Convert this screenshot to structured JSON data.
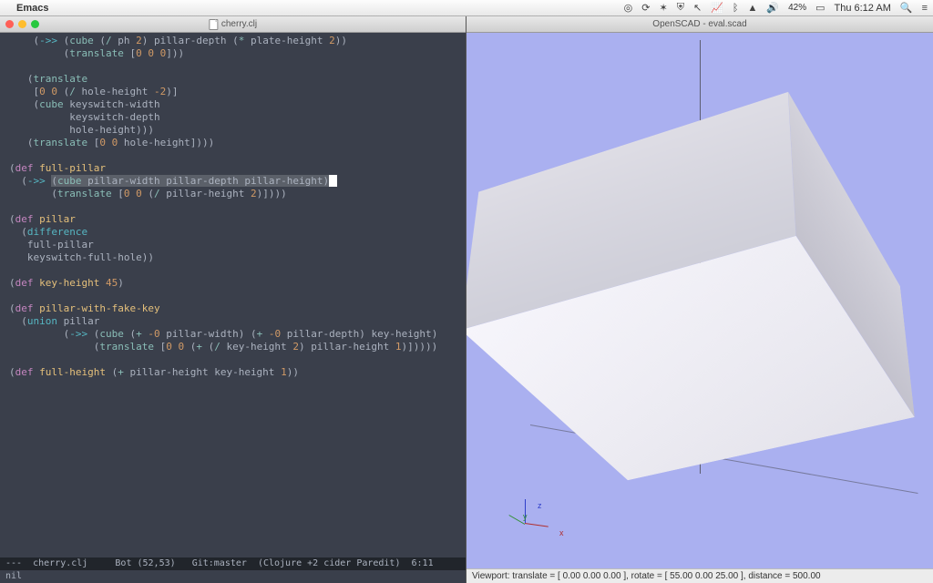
{
  "mac_menubar": {
    "app_name": "Emacs",
    "battery_pct": "42%",
    "clock": "Thu 6:12 AM"
  },
  "emacs": {
    "title_filename": "cherry.clj",
    "minibuffer": "nil",
    "modeline": "---  cherry.clj     Bot (52,53)   Git:master  (Clojure +2 cider Paredit)  6:11",
    "code_lines": [
      "    (->> (cube (/ ph 2) pillar-depth (* plate-height 2))",
      "         (translate [0 0 0]))",
      "",
      "   (translate",
      "    [0 0 (/ hole-height -2)]",
      "    (cube keyswitch-width",
      "          keyswitch-depth",
      "          hole-height)))",
      "   (translate [0 0 hole-height])))",
      "",
      "(def full-pillar",
      "  (->> (cube pillar-width pillar-depth pillar-height)",
      "       (translate [0 0 (/ pillar-height 2)])))",
      "",
      "(def pillar",
      "  (difference",
      "   full-pillar",
      "   keyswitch-full-hole))",
      "",
      "(def key-height 45)",
      "",
      "(def pillar-with-fake-key",
      "  (union pillar",
      "         (->> (cube (+ -0 pillar-width) (+ -0 pillar-depth) key-height)",
      "              (translate [0 0 (+ (/ key-height 2) pillar-height 1)]))))",
      "",
      "(def full-height (+ pillar-height key-height 1))"
    ]
  },
  "openscad": {
    "title": "OpenSCAD - eval.scad",
    "statusbar": "Viewport: translate = [ 0.00 0.00 0.00 ], rotate = [ 55.00 0.00 25.00 ], distance = 500.00"
  }
}
